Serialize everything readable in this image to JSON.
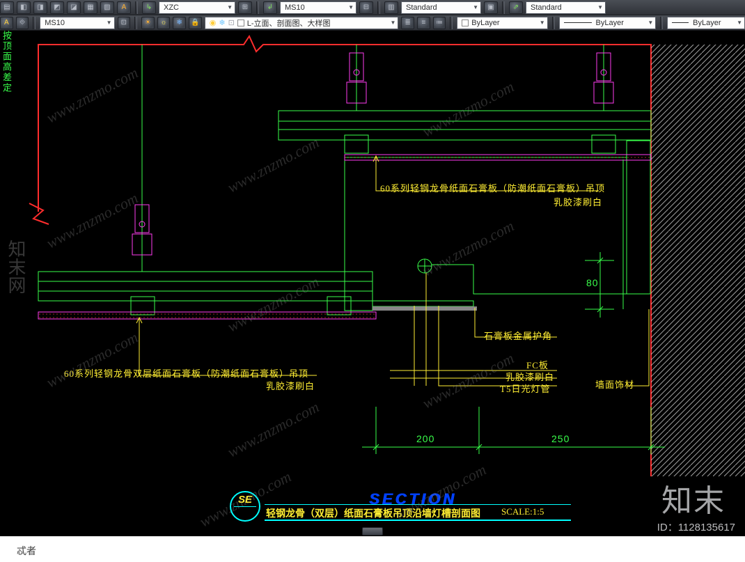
{
  "toolbar": {
    "row1": {
      "dd1": "XZC",
      "dd2": "MS10",
      "dd3": "Standard",
      "dd4": "Standard"
    },
    "row2": {
      "dd1": "MS10",
      "layer": "L-立面、剖面图、大样图",
      "color": "ByLayer",
      "ltype": "ByLayer",
      "lweight": "ByLayer"
    }
  },
  "annotations": {
    "upper_right1": "60系列轻钢龙骨纸面石膏板（防潮纸面石膏板）吊顶",
    "upper_right2": "乳胶漆刷白",
    "mid_corner": "石膏板金属护角",
    "mid_right1": "FC板",
    "mid_right2": "乳胶漆刷白",
    "mid_right3": "T5日光灯管",
    "wall_right": "墙面饰材",
    "left1": "60系列轻钢龙骨双层纸面石膏板（防潮纸面石膏板）吊顶",
    "left2": "乳胶漆刷白",
    "vert_label": "按顶面高差定"
  },
  "dimensions": {
    "d80": "80",
    "d200": "200",
    "d250": "250"
  },
  "title": {
    "tag": "SE",
    "word": "SECTION",
    "name": "轻钢龙骨（双层）纸面石膏板吊顶沿墙灯槽剖面图",
    "scale": "SCALE:1:5"
  },
  "watermark": {
    "url": "www.znzmo.com",
    "cn_side": "知末网",
    "logo": "知末",
    "id": "ID：1128135617",
    "corner": "忒者"
  }
}
